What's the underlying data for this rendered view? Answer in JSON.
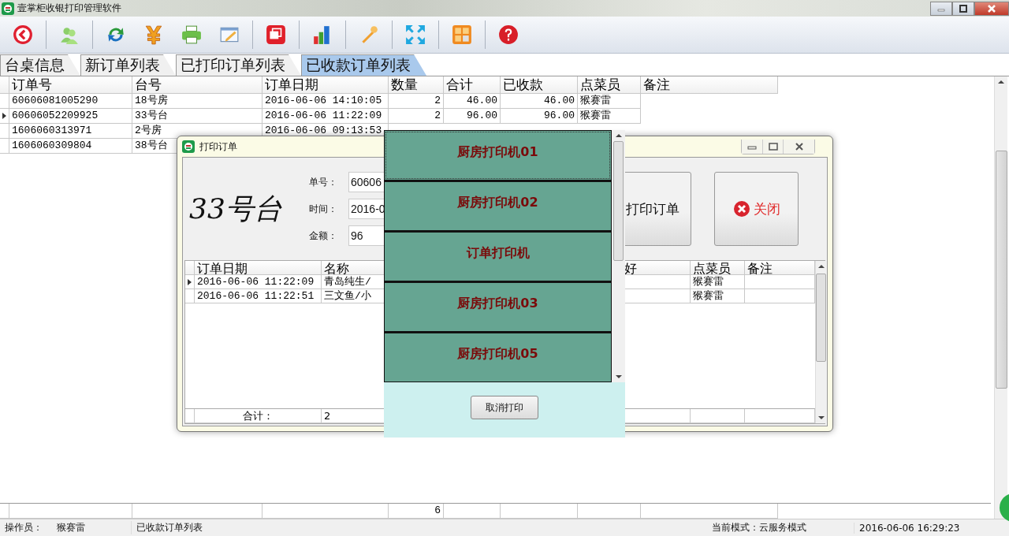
{
  "window": {
    "title": "壹掌柜收银打印管理软件"
  },
  "toolbar_groups": [
    [
      {
        "kind": "back"
      }
    ],
    [
      {
        "kind": "users"
      }
    ],
    [
      {
        "kind": "refresh"
      },
      {
        "kind": "yen"
      },
      {
        "kind": "printer"
      },
      {
        "kind": "edit"
      }
    ],
    [
      {
        "kind": "cards"
      }
    ],
    [
      {
        "kind": "chart"
      }
    ],
    [
      {
        "kind": "wrench"
      }
    ],
    [
      {
        "kind": "expand"
      }
    ],
    [
      {
        "kind": "grid"
      }
    ],
    [
      {
        "kind": "help"
      }
    ]
  ],
  "tabs": [
    {
      "label": "台桌信息",
      "selected": false
    },
    {
      "label": "新订单列表",
      "selected": false
    },
    {
      "label": "已打印订单列表",
      "selected": false
    },
    {
      "label": "已收款订单列表",
      "selected": true
    }
  ],
  "table": {
    "columns": [
      "订单号",
      "台号",
      "订单日期",
      "数量",
      "合计",
      "已收款",
      "点菜员",
      "备注"
    ],
    "rows": [
      {
        "current": false,
        "cells": [
          "60606081005290",
          "18号房",
          "2016-06-06 14:10:05",
          "2",
          "46.00",
          "46.00",
          "猴赛雷"
        ]
      },
      {
        "current": true,
        "cells": [
          "60606052209925",
          "33号台",
          "2016-06-06 11:22:09",
          "2",
          "96.00",
          "96.00",
          "猴赛雷"
        ]
      },
      {
        "current": false,
        "cells": [
          "1606060313971",
          "2号房",
          "2016-06-06 09:13:53"
        ]
      },
      {
        "current": false,
        "cells": [
          "1606060309804",
          "38号台"
        ]
      }
    ],
    "footer": {
      "quantity": "6"
    }
  },
  "dialog": {
    "title": "打印订单",
    "table_name": "33号台",
    "fields": [
      {
        "label": "单号：",
        "value": "60606"
      },
      {
        "label": "时间：",
        "value": "2016-0"
      },
      {
        "label": "金额：",
        "value": "96"
      }
    ],
    "buttons": [
      {
        "kind": "print",
        "label": "打印订单"
      },
      {
        "kind": "close",
        "label": "关闭"
      }
    ],
    "grid": {
      "columns": [
        "订单日期",
        "名称",
        "好",
        "点菜员",
        "备注"
      ],
      "rows": [
        {
          "current": true,
          "cells": [
            "2016-06-06 11:22:09",
            "青岛纯生/"
          ],
          "staff": "猴赛雷"
        },
        {
          "current": false,
          "cells": [
            "2016-06-06 11:22:51",
            "三文鱼/小"
          ],
          "staff": "猴赛雷"
        }
      ],
      "footer": {
        "label": "合计：",
        "count": "2"
      }
    }
  },
  "printer_menu": {
    "printers": [
      "厨房打印机01",
      "厨房打印机02",
      "订单打印机",
      "厨房打印机03",
      "厨房打印机05"
    ],
    "cancel": "取消打印"
  },
  "status_bar": {
    "operator_label": "操作员：",
    "operator": "猴赛雷",
    "view": "已收款订单列表",
    "mode": "当前模式：云服务模式",
    "time": "2016-06-06 16:29:23"
  }
}
